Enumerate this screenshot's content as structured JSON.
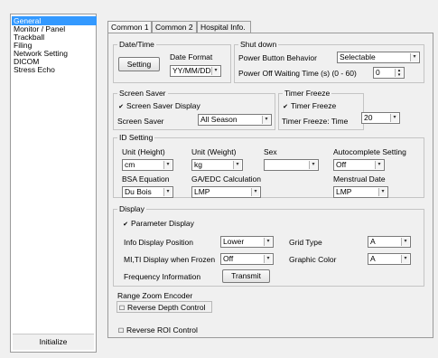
{
  "sidebar": {
    "items": [
      "General",
      "Monitor / Panel",
      "Trackball",
      "Filing",
      "Network Setting",
      "DICOM",
      "Stress Echo"
    ],
    "selected": "General",
    "initialize_label": "Initialize"
  },
  "tabs": [
    "Common 1",
    "Common 2",
    "Hospital Info."
  ],
  "active_tab": "Common 1",
  "datetime": {
    "title": "Date/Time",
    "setting_label": "Setting",
    "date_format_label": "Date Format",
    "date_format_value": "YY/MM/DD"
  },
  "shutdown": {
    "title": "Shut down",
    "power_button_label": "Power Button Behavior",
    "power_button_value": "Selectable",
    "power_off_wait_label": "Power Off Waiting Time (s) (0 - 60)",
    "power_off_wait_value": "0"
  },
  "screen_saver": {
    "title": "Screen Saver",
    "display_label": "Screen Saver Display",
    "display_checked": true,
    "saver_label": "Screen Saver",
    "saver_value": "All Season"
  },
  "timer_freeze": {
    "title": "Timer Freeze",
    "checkbox_label": "Timer Freeze",
    "checked": true,
    "time_label": "Timer Freeze: Time",
    "time_value": "20"
  },
  "id_setting": {
    "title": "ID Setting",
    "unit_height_label": "Unit (Height)",
    "unit_height_value": "cm",
    "unit_weight_label": "Unit (Weight)",
    "unit_weight_value": "kg",
    "sex_label": "Sex",
    "sex_value": "",
    "autocomplete_label": "Autocomplete Setting",
    "autocomplete_value": "Off",
    "bsa_label": "BSA Equation",
    "bsa_value": "Du Bois",
    "ga_label": "GA/EDC Calculation",
    "ga_value": "LMP",
    "menstrual_label": "Menstrual Date",
    "menstrual_value": "LMP"
  },
  "display": {
    "title": "Display",
    "param_label": "Parameter Display",
    "param_checked": true,
    "info_pos_label": "Info Display Position",
    "info_pos_value": "Lower",
    "grid_label": "Grid Type",
    "grid_value": "A",
    "miti_label": "MI,TI Display when Frozen",
    "miti_value": "Off",
    "graphic_label": "Graphic Color",
    "graphic_value": "A",
    "freq_label": "Frequency Information",
    "transmit_label": "Transmit"
  },
  "range_zoom": {
    "title": "Range Zoom Encoder",
    "reverse_depth_label": "Reverse Depth Control",
    "reverse_depth_checked": false
  },
  "reverse_roi": {
    "label": "Reverse ROI Control",
    "checked": false
  },
  "glyphs": {
    "checked": "✔",
    "unchecked": "☐",
    "dropdown": "▾",
    "spin_up": "▴",
    "spin_down": "▾"
  }
}
